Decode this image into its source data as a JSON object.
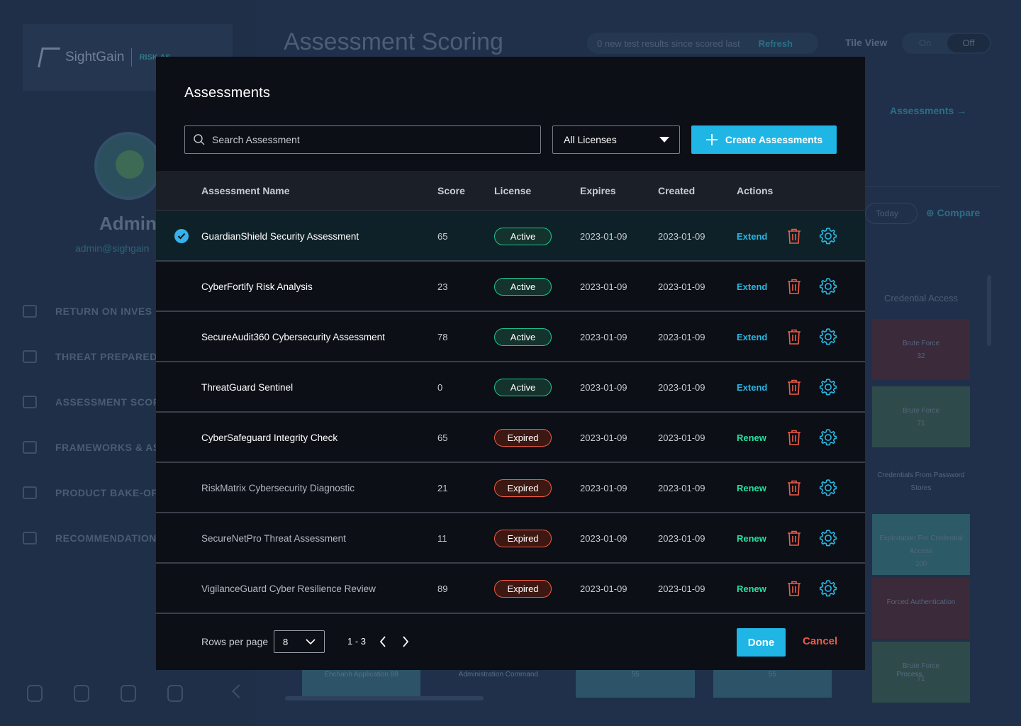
{
  "background": {
    "brand": "SightGain",
    "brand_suffix": "RISK AS",
    "page_title": "Assessment Scoring",
    "test_results_text": "0 new test results since scored last",
    "refresh_label": "Refresh",
    "tile_view_label": "Tile View",
    "toggle_on": "On",
    "toggle_off": "Off",
    "assessments_link": "Assessments",
    "today_label": "Today",
    "compare_label": "Compare",
    "user_name": "Admin",
    "user_email": "admin@sighgain",
    "nav": [
      {
        "label": "RETURN ON INVES"
      },
      {
        "label": "THREAT PREPARED"
      },
      {
        "label": "ASSESSMENT SCOR"
      },
      {
        "label": "FRAMEWORKS & AS"
      },
      {
        "label": "PRODUCT BAKE-OF"
      },
      {
        "label": "RECOMMENDATION"
      }
    ],
    "right_column_title": "Credential Access",
    "right_cards": [
      {
        "title": "Brute Force",
        "value": "32"
      },
      {
        "title": "Brute Force",
        "value": "71"
      },
      {
        "title": "Credentials From Password Stores",
        "value": ""
      },
      {
        "title": "Exploitation For Credential Access",
        "value": "100"
      },
      {
        "title": "Forced Authentication",
        "value": ""
      },
      {
        "title": "Brute Force",
        "value": "71"
      }
    ],
    "bottom_strip": [
      {
        "label": "Ehchanh Application",
        "value": "88"
      },
      {
        "label": "Administration Command",
        "value": ""
      },
      {
        "label": "",
        "value": "55"
      },
      {
        "label": "",
        "value": "55"
      },
      {
        "label": "Process",
        "value": ""
      }
    ]
  },
  "modal": {
    "title": "Assessments",
    "search_placeholder": "Search Assessment",
    "license_filter": "All Licenses",
    "create_label": "Create Assessments",
    "columns": {
      "name": "Assessment Name",
      "score": "Score",
      "license": "License",
      "expires": "Expires",
      "created": "Created",
      "actions": "Actions"
    },
    "rows": [
      {
        "name": "GuardianShield Security Assessment",
        "score": "65",
        "license": "Active",
        "expires": "2023-01-09",
        "created": "2023-01-09",
        "action": "Extend",
        "selected": true
      },
      {
        "name": "CyberFortify Risk Analysis",
        "score": "23",
        "license": "Active",
        "expires": "2023-01-09",
        "created": "2023-01-09",
        "action": "Extend",
        "selected": false
      },
      {
        "name": "SecureAudit360 Cybersecurity Assessment",
        "score": "78",
        "license": "Active",
        "expires": "2023-01-09",
        "created": "2023-01-09",
        "action": "Extend",
        "selected": false
      },
      {
        "name": "ThreatGuard Sentinel",
        "score": "0",
        "license": "Active",
        "expires": "2023-01-09",
        "created": "2023-01-09",
        "action": "Extend",
        "selected": false
      },
      {
        "name": "CyberSafeguard Integrity Check",
        "score": "65",
        "license": "Expired",
        "expires": "2023-01-09",
        "created": "2023-01-09",
        "action": "Renew",
        "selected": false
      },
      {
        "name": "RiskMatrix Cybersecurity Diagnostic",
        "score": "21",
        "license": "Expired",
        "expires": "2023-01-09",
        "created": "2023-01-09",
        "action": "Renew",
        "selected": false
      },
      {
        "name": "SecureNetPro Threat Assessment",
        "score": "11",
        "license": "Expired",
        "expires": "2023-01-09",
        "created": "2023-01-09",
        "action": "Renew",
        "selected": false
      },
      {
        "name": "VigilanceGuard Cyber Resilience Review",
        "score": "89",
        "license": "Expired",
        "expires": "2023-01-09",
        "created": "2023-01-09",
        "action": "Renew",
        "selected": false
      }
    ],
    "rows_per_page_label": "Rows per page",
    "rows_per_page_value": "8",
    "range_text": "1 - 3",
    "done_label": "Done",
    "cancel_label": "Cancel"
  },
  "colors": {
    "accent": "#1fb6e6",
    "active": "#1ec792",
    "expired": "#f05b45",
    "renew": "#26e09c",
    "trash": "#f05b45",
    "gear": "#2ab6e0"
  }
}
